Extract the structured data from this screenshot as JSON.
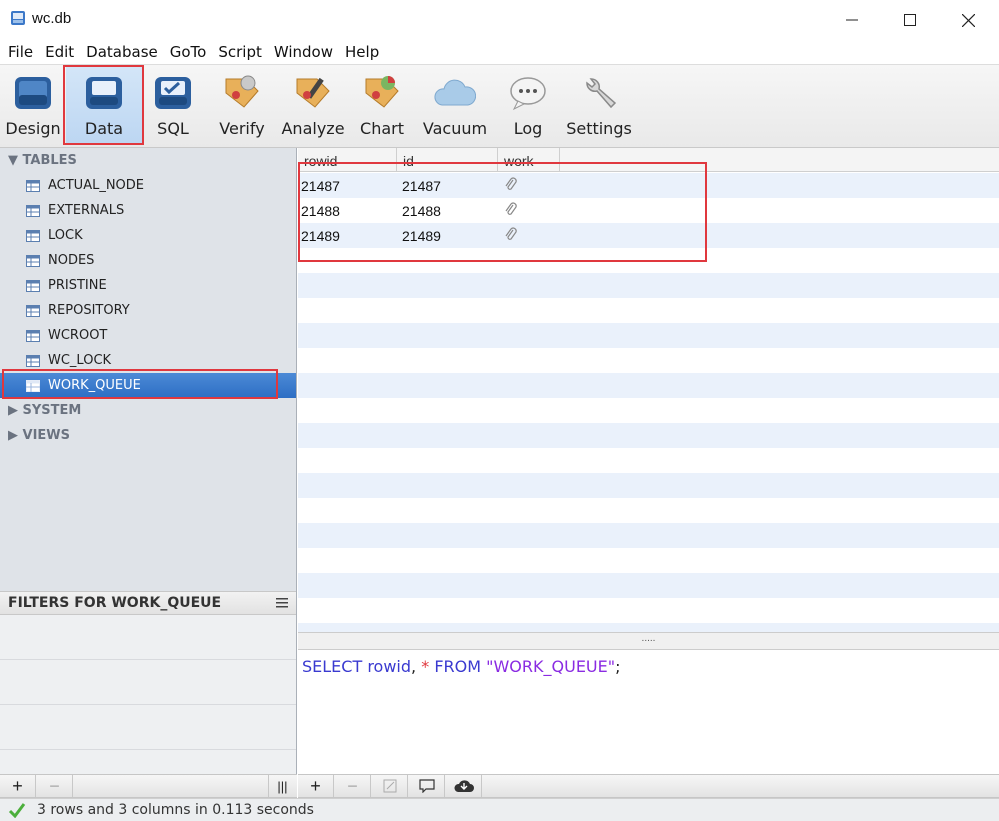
{
  "window": {
    "title": "wc.db",
    "icon": "database-app-icon"
  },
  "menu": [
    "File",
    "Edit",
    "Database",
    "GoTo",
    "Script",
    "Window",
    "Help"
  ],
  "toolbar": {
    "active": "Data",
    "items": [
      {
        "label": "Design",
        "icon": "design-icon"
      },
      {
        "label": "Data",
        "icon": "data-icon"
      },
      {
        "label": "SQL",
        "icon": "sql-icon"
      },
      {
        "label": "Verify",
        "icon": "verify-icon"
      },
      {
        "label": "Analyze",
        "icon": "analyze-icon"
      },
      {
        "label": "Chart",
        "icon": "chart-icon"
      },
      {
        "label": "Vacuum",
        "icon": "vacuum-icon"
      },
      {
        "label": "Log",
        "icon": "log-icon"
      },
      {
        "label": "Settings",
        "icon": "settings-icon"
      }
    ]
  },
  "sidebar": {
    "tables_heading": "TABLES",
    "tables": [
      "ACTUAL_NODE",
      "EXTERNALS",
      "LOCK",
      "NODES",
      "PRISTINE",
      "REPOSITORY",
      "WCROOT",
      "WC_LOCK",
      "WORK_QUEUE"
    ],
    "selected": "WORK_QUEUE",
    "system_heading": "SYSTEM",
    "views_heading": "VIEWS"
  },
  "filters": {
    "title": "FILTERS FOR WORK_QUEUE"
  },
  "grid": {
    "columns": [
      "rowid",
      "id",
      "work"
    ],
    "rows": [
      [
        "21487",
        "21487",
        "attachment-icon"
      ],
      [
        "21488",
        "21488",
        "attachment-icon"
      ],
      [
        "21489",
        "21489",
        "attachment-icon"
      ]
    ]
  },
  "splitter": {
    "handle": "....."
  },
  "sql": {
    "select": "SELECT",
    "rowid": "rowid",
    "comma": ",",
    "star": "*",
    "from": "FROM",
    "table": "\"WORK_QUEUE\"",
    "semi": ";"
  },
  "status": {
    "message": "3 rows and 3 columns in 0.113 seconds"
  },
  "colors": {
    "highlight": "#e0383e",
    "selection": "#2d6ec4",
    "stripe": "#eaf1fb"
  }
}
